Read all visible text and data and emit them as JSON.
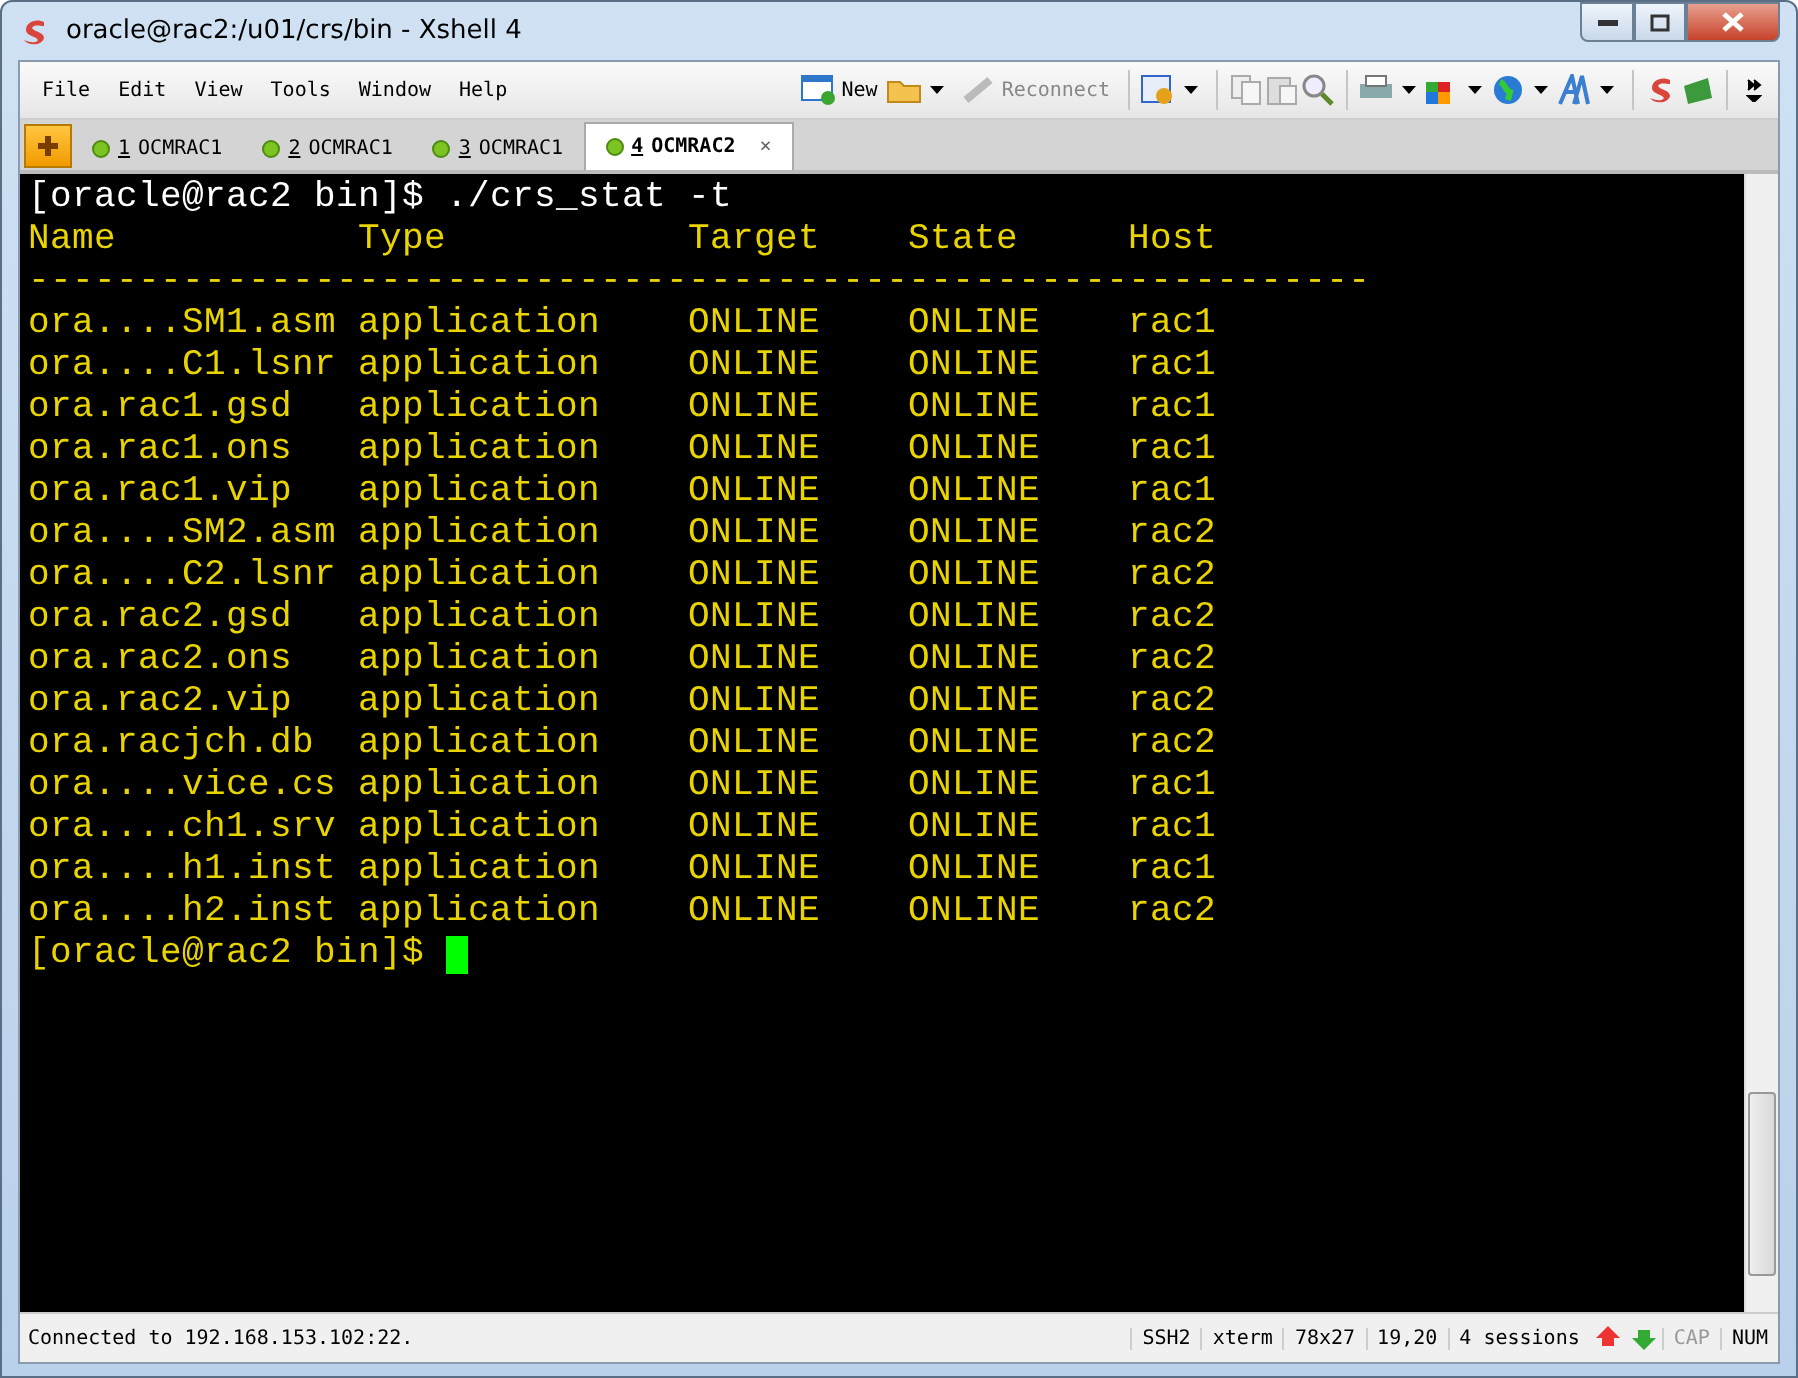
{
  "window": {
    "title": "oracle@rac2:/u01/crs/bin - Xshell 4"
  },
  "menu": [
    "File",
    "Edit",
    "View",
    "Tools",
    "Window",
    "Help"
  ],
  "toolbar": [
    {
      "kind": "new",
      "label": "New",
      "disabled": false
    },
    {
      "kind": "reconnect",
      "label": "Reconnect",
      "disabled": true
    }
  ],
  "tabs": [
    {
      "number": "1",
      "label": "OCMRAC1",
      "selected": false
    },
    {
      "number": "2",
      "label": "OCMRAC1",
      "selected": false
    },
    {
      "number": "3",
      "label": "OCMRAC1",
      "selected": false
    },
    {
      "number": "4",
      "label": "OCMRAC2",
      "selected": true,
      "close": "×"
    }
  ],
  "terminal": {
    "command_line": "[oracle@rac2 bin]$ ./crs_stat -t",
    "columns": [
      "Name",
      "Type",
      "Target",
      "State",
      "Host"
    ],
    "separator": "-------------------------------------------------------------",
    "rows": [
      [
        "ora....SM1.asm",
        "application",
        "ONLINE",
        "ONLINE",
        "rac1"
      ],
      [
        "ora....C1.lsnr",
        "application",
        "ONLINE",
        "ONLINE",
        "rac1"
      ],
      [
        "ora.rac1.gsd",
        "application",
        "ONLINE",
        "ONLINE",
        "rac1"
      ],
      [
        "ora.rac1.ons",
        "application",
        "ONLINE",
        "ONLINE",
        "rac1"
      ],
      [
        "ora.rac1.vip",
        "application",
        "ONLINE",
        "ONLINE",
        "rac1"
      ],
      [
        "ora....SM2.asm",
        "application",
        "ONLINE",
        "ONLINE",
        "rac2"
      ],
      [
        "ora....C2.lsnr",
        "application",
        "ONLINE",
        "ONLINE",
        "rac2"
      ],
      [
        "ora.rac2.gsd",
        "application",
        "ONLINE",
        "ONLINE",
        "rac2"
      ],
      [
        "ora.rac2.ons",
        "application",
        "ONLINE",
        "ONLINE",
        "rac2"
      ],
      [
        "ora.rac2.vip",
        "application",
        "ONLINE",
        "ONLINE",
        "rac2"
      ],
      [
        "ora.racjch.db",
        "application",
        "ONLINE",
        "ONLINE",
        "rac2"
      ],
      [
        "ora....vice.cs",
        "application",
        "ONLINE",
        "ONLINE",
        "rac1"
      ],
      [
        "ora....ch1.srv",
        "application",
        "ONLINE",
        "ONLINE",
        "rac1"
      ],
      [
        "ora....h1.inst",
        "application",
        "ONLINE",
        "ONLINE",
        "rac1"
      ],
      [
        "ora....h2.inst",
        "application",
        "ONLINE",
        "ONLINE",
        "rac2"
      ]
    ],
    "prompt": "[oracle@rac2 bin]$"
  },
  "status_bar": {
    "message": "Connected to 192.168.153.102:22.",
    "fields": [
      "SSH2",
      "xterm",
      "78x27",
      "19,20",
      "4 sessions"
    ],
    "indicators": [
      {
        "label": "CAP",
        "on": false
      },
      {
        "label": "NUM",
        "on": true
      }
    ]
  }
}
